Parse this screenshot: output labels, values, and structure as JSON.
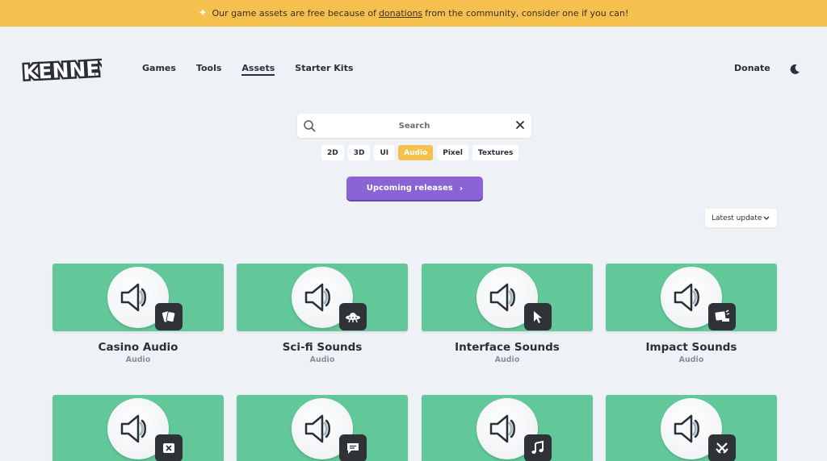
{
  "banner": {
    "text_before": "Our game assets are free because of",
    "link": "donations",
    "text_after": "from the community, consider one if you can!"
  },
  "header": {
    "logo_text": "KENNEY",
    "nav": [
      {
        "label": "Games"
      },
      {
        "label": "Tools"
      },
      {
        "label": "Assets",
        "active": true
      },
      {
        "label": "Starter Kits"
      }
    ],
    "donate_label": "Donate"
  },
  "search": {
    "placeholder": "Search"
  },
  "filters": [
    {
      "label": "2D"
    },
    {
      "label": "3D"
    },
    {
      "label": "UI"
    },
    {
      "label": "Audio",
      "active": true
    },
    {
      "label": "Pixel"
    },
    {
      "label": "Textures"
    }
  ],
  "upcoming_label": "Upcoming releases",
  "sort": {
    "selected": "Latest update"
  },
  "colors": {
    "accent": "#f6c04f",
    "purple": "#8a63d4",
    "card_green": "#62c89a"
  },
  "cards": [
    {
      "title": "Casino Audio",
      "category": "Audio",
      "badge_icon": "cards-icon"
    },
    {
      "title": "Sci-fi Sounds",
      "category": "Audio",
      "badge_icon": "ufo-icon"
    },
    {
      "title": "Interface Sounds",
      "category": "Audio",
      "badge_icon": "cursor-icon"
    },
    {
      "title": "Impact Sounds",
      "category": "Audio",
      "badge_icon": "impact-icon"
    },
    {
      "title": "",
      "category": "",
      "badge_icon": "close-box-icon"
    },
    {
      "title": "",
      "category": "",
      "badge_icon": "chat-icon"
    },
    {
      "title": "",
      "category": "",
      "badge_icon": "music-note-icon"
    },
    {
      "title": "",
      "category": "",
      "badge_icon": "swords-icon"
    }
  ]
}
